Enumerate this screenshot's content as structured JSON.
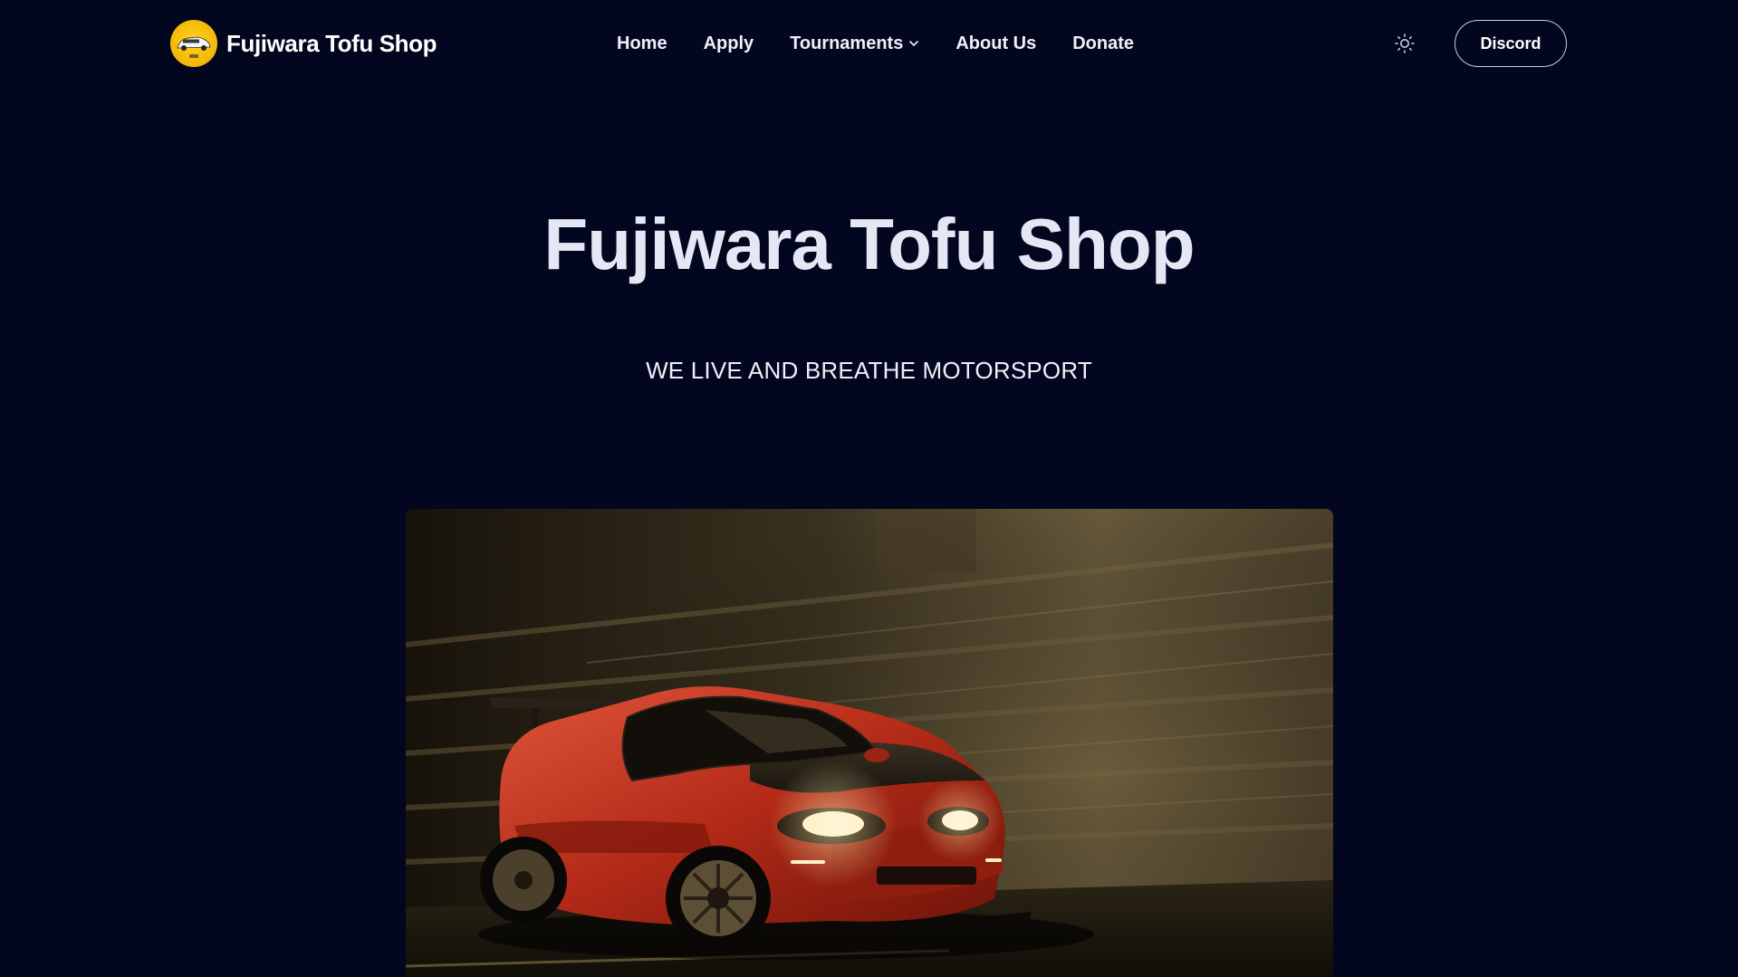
{
  "brand": {
    "name": "Fujiwara Tofu Shop",
    "logo_icon": "car-logo-icon"
  },
  "nav": {
    "items": [
      {
        "label": "Home"
      },
      {
        "label": "Apply"
      },
      {
        "label": "Tournaments",
        "icon": "chevron-down-icon"
      },
      {
        "label": "About Us"
      },
      {
        "label": "Donate"
      }
    ],
    "theme_toggle_icon": "sun-icon",
    "discord_label": "Discord"
  },
  "hero": {
    "title": "Fujiwara Tofu Shop",
    "subtitle": "WE LIVE AND BREATHE MOTORSPORT"
  },
  "colors": {
    "background": "#03061f",
    "text": "#e8ebf5",
    "logo_yellow": "#f2b705",
    "car_red": "#c8321e"
  }
}
